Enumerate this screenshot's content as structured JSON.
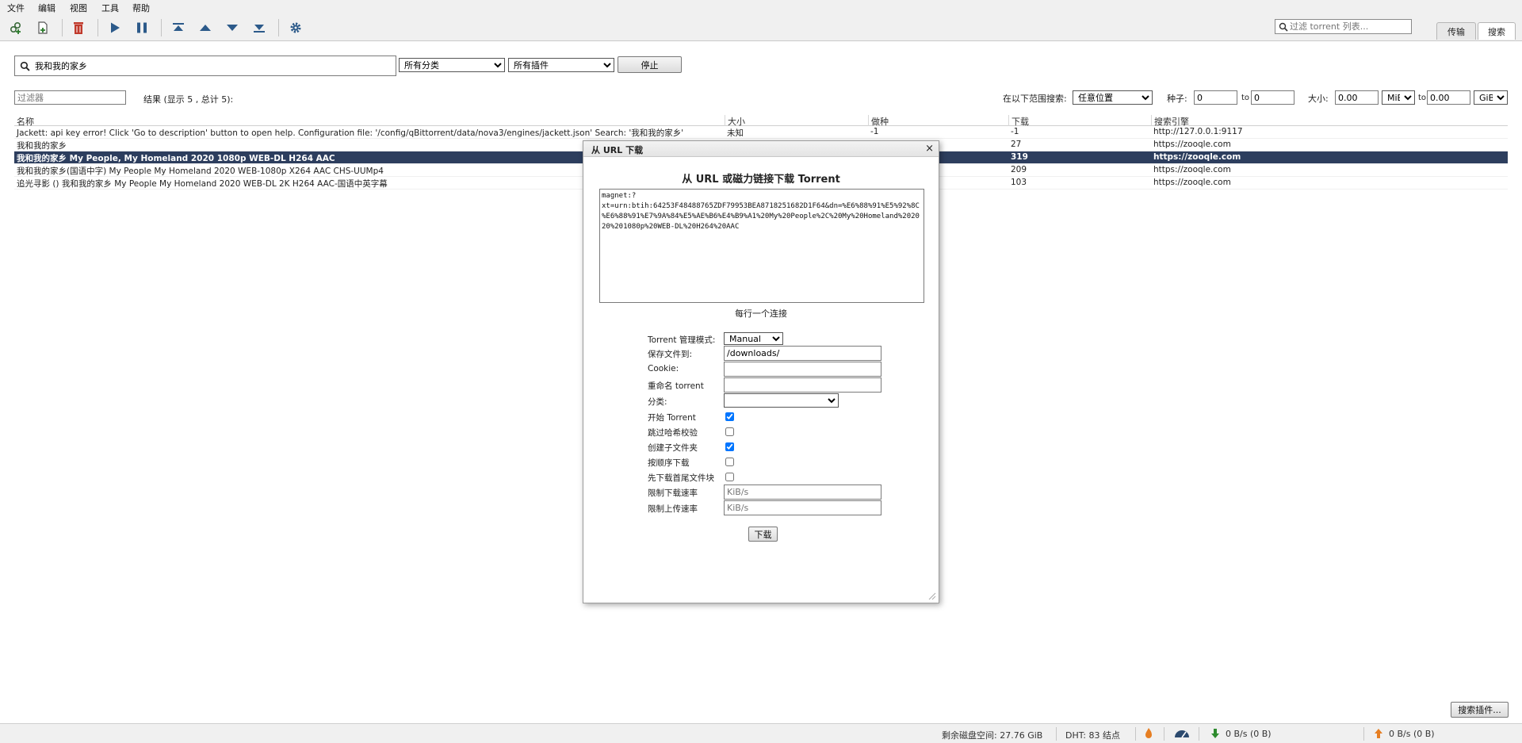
{
  "menu": [
    "文件",
    "编辑",
    "视图",
    "工具",
    "帮助"
  ],
  "toolbar": {
    "filter_placeholder": "过滤 torrent 列表...",
    "tabs": [
      "传输",
      "搜索"
    ]
  },
  "search": {
    "query": "我和我的家乡",
    "category": "所有分类",
    "plugin": "所有插件",
    "stop_button": "停止",
    "filter_placeholder": "过滤器",
    "results_label": "结果 (显示 5 , 总计 5):",
    "range_label": "在以下范围搜索:",
    "range_value": "任意位置",
    "seeds_label": "种子:",
    "seeds_min": "0",
    "to1": "to",
    "seeds_max": "0",
    "size_label": "大小:",
    "size_min": "0.00",
    "size_min_unit": "MiB",
    "to2": "to",
    "size_max": "0.00",
    "size_max_unit": "GiB"
  },
  "table": {
    "columns": [
      "名称",
      "大小",
      "做种",
      "下载",
      "搜索引擎"
    ],
    "rows": [
      {
        "name": "Jackett: api key error! Click 'Go to description' button to open help. Configuration file: '/config/qBittorrent/data/nova3/engines/jackett.json' Search: '我和我的家乡'",
        "size": "未知",
        "seeds": "-1",
        "leech": "-1",
        "engine": "http://127.0.0.1:9117"
      },
      {
        "name": "我和我的家乡",
        "size": "",
        "seeds": "",
        "leech": "27",
        "engine": "https://zooqle.com"
      },
      {
        "name": "我和我的家乡 My People, My Homeland 2020 1080p WEB-DL H264 AAC",
        "size": "",
        "seeds": "",
        "leech": "319",
        "engine": "https://zooqle.com"
      },
      {
        "name": "我和我的家乡(国语中字) My People My Homeland 2020 WEB-1080p X264 AAC CHS-UUMp4",
        "size": "",
        "seeds": "",
        "leech": "209",
        "engine": "https://zooqle.com"
      },
      {
        "name": "追光寻影 () 我和我的家乡 My People My Homeland 2020 WEB-DL 2K H264 AAC-国语中英字幕",
        "size": "",
        "seeds": "",
        "leech": "103",
        "engine": "https://zooqle.com"
      }
    ]
  },
  "dialog": {
    "title": "从 URL 下载",
    "close": "×",
    "heading": "从 URL 或磁力链接下载 Torrent",
    "url_value": "magnet:?xt=urn:btih:64253F48488765ZDF79953BEA8718251682D1F64&dn=%E6%88%91%E5%92%8C%E6%88%91%E7%9A%84%E5%AE%B6%E4%B9%A1%20My%20People%2C%20My%20Homeland%202020%201080p%20WEB-DL%20H264%20AAC",
    "hint": "每行一个连接",
    "fields": {
      "mode_label": "Torrent 管理模式:",
      "mode_value": "Manual",
      "save_label": "保存文件到:",
      "save_value": "/downloads/",
      "cookie_label": "Cookie:",
      "rename_label": "重命名 torrent",
      "category_label": "分类:",
      "start_label": "开始 Torrent",
      "skip_hash_label": "跳过哈希校验",
      "subfolder_label": "创建子文件夹",
      "sequential_label": "按顺序下载",
      "first_last_label": "先下载首尾文件块",
      "dl_limit_label": "限制下载速率",
      "dl_limit_placeholder": "KiB/s",
      "ul_limit_label": "限制上传速率",
      "ul_limit_placeholder": "KiB/s"
    },
    "submit": "下载"
  },
  "search_plugins_button": "搜索插件...",
  "status": {
    "disk_free": "剩余磁盘空间: 27.76 GiB",
    "dht": "DHT: 83 结点",
    "download": "0 B/s (0 B)",
    "upload": "0 B/s (0 B)"
  },
  "colors": {
    "selected_row": "#2d3e5e",
    "toolbar_bg": "#f0f0f0",
    "delete_icon": "#c0392b",
    "play_icon": "#2c5a8a"
  }
}
